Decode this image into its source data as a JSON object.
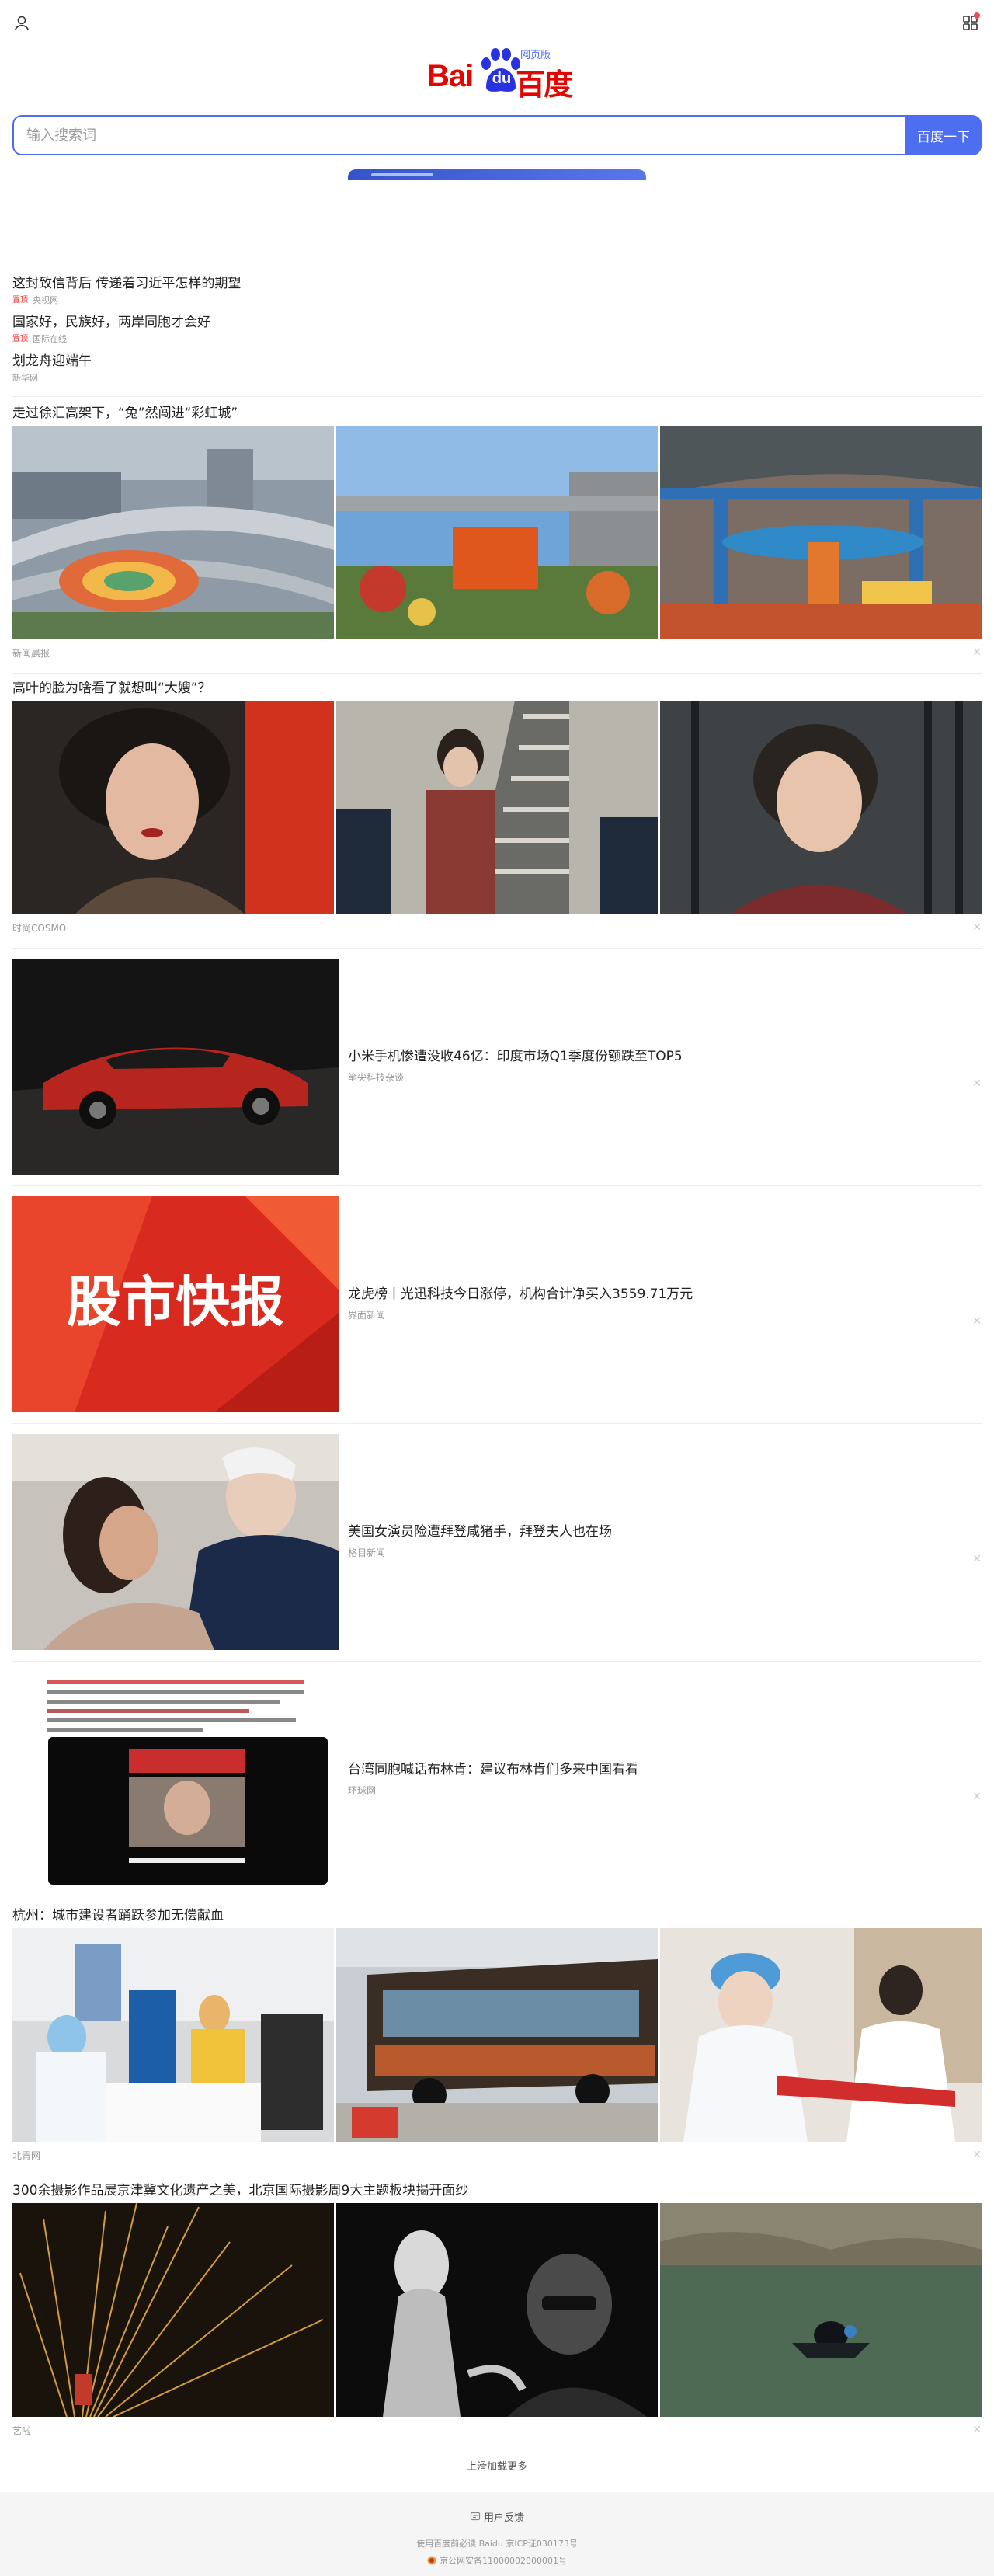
{
  "header": {
    "logo": {
      "bai": "Bai",
      "du": "du",
      "cn": "百度",
      "sub": "网页版"
    }
  },
  "search": {
    "placeholder": "输入搜索词",
    "button_label": "百度一下"
  },
  "hot_news": [
    {
      "title": "这封致信背后 传递着习近平怎样的期望",
      "tag": "置顶",
      "source": "央视网"
    },
    {
      "title": "国家好，民族好，两岸同胞才会好",
      "tag": "置顶",
      "source": "国际在线"
    },
    {
      "title": "划龙舟迎端午",
      "tag": "",
      "source": "新华网"
    }
  ],
  "feed": [
    {
      "type": "tri",
      "title": "走过徐汇高架下，“兔”然闯进“彩虹城”",
      "source": "新闻晨报",
      "images": [
        "overpass-rainbow-park",
        "xuhui-sign-garden",
        "rainbow-playground-under-bridge"
      ]
    },
    {
      "type": "tri",
      "title": "高叶的脸为啥看了就想叫“大嫂”？",
      "source": "时尚COSMO",
      "images": [
        "actress-portrait-red",
        "actress-stairs-officers",
        "actress-smiling-bars"
      ]
    },
    {
      "type": "side",
      "title": "小米手机惨遭没收46亿：印度市场Q1季度份额跌至TOP5",
      "source": "笔尖科技杂谈",
      "image": "red-sports-car"
    },
    {
      "type": "side",
      "title": "龙虎榜丨光迅科技今日涨停，机构合计净买入3559.71万元",
      "source": "界面新闻",
      "image": "stock-news-red-poster"
    },
    {
      "type": "side",
      "title": "美国女演员险遭拜登咸猪手，拜登夫人也在场",
      "source": "格目新闻",
      "image": "biden-embrace-photo"
    },
    {
      "type": "side",
      "title": "台湾同胞喊话布林肯：建议布林肯们多来中国看看",
      "source": "环球网",
      "image": "video-screenshot-news"
    },
    {
      "type": "tri",
      "title": "杭州：城市建设者踊跃参加无偿献血",
      "source": "北青网",
      "images": [
        "workers-blood-drive",
        "blood-donation-bus",
        "nurse-drawing-blood"
      ]
    },
    {
      "type": "tri",
      "title": "300余摄影作品展京津冀文化遗产之美，北京国际摄影周9大主题板块揭开面纱",
      "source": "艺啦",
      "images": [
        "iron-sparks-fireworks",
        "sculpture-photographer-bw",
        "diver-underwater-ruins"
      ]
    }
  ],
  "load_more": "上滑加载更多",
  "footer": {
    "feedback": "用户反馈",
    "line1": "使用百度前必读 Baidu 京ICP证030173号",
    "line2": "京公网安备11000002000001号"
  },
  "colors": {
    "accent": "#4e6ef2",
    "brand_red": "#e10601",
    "tag_red": "#e33333"
  },
  "icons": [
    "user-icon",
    "apps-icon",
    "close-icon",
    "feedback-icon",
    "police-badge-icon"
  ]
}
